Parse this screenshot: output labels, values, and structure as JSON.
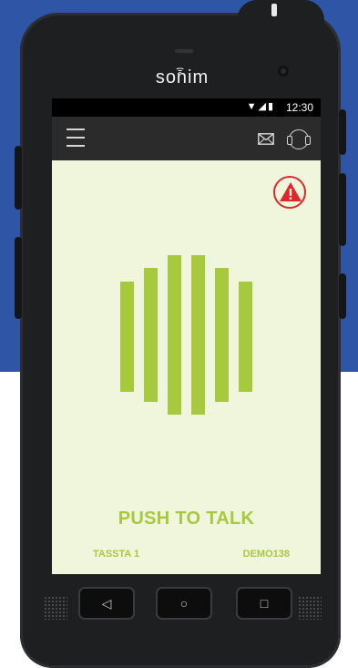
{
  "device": {
    "brand": "sonim"
  },
  "status_bar": {
    "time": "12:30",
    "icons": "▼◢▮"
  },
  "app_bar": {
    "menu_icon": "hamburger-menu-icon",
    "mail_icon": "envelope-icon",
    "headset_icon": "headset-icon"
  },
  "main": {
    "emergency_icon": "warning-triangle-icon",
    "ptt_label": "PUSH TO TALK",
    "footer_left": "TASSTA 1",
    "footer_right": "DEMO138",
    "accent_color": "#a6c93e",
    "alert_color": "#e0262b",
    "background_color": "#f0f6dc"
  },
  "nav_buttons": {
    "back": "◁",
    "home": "○",
    "recent": "□"
  }
}
